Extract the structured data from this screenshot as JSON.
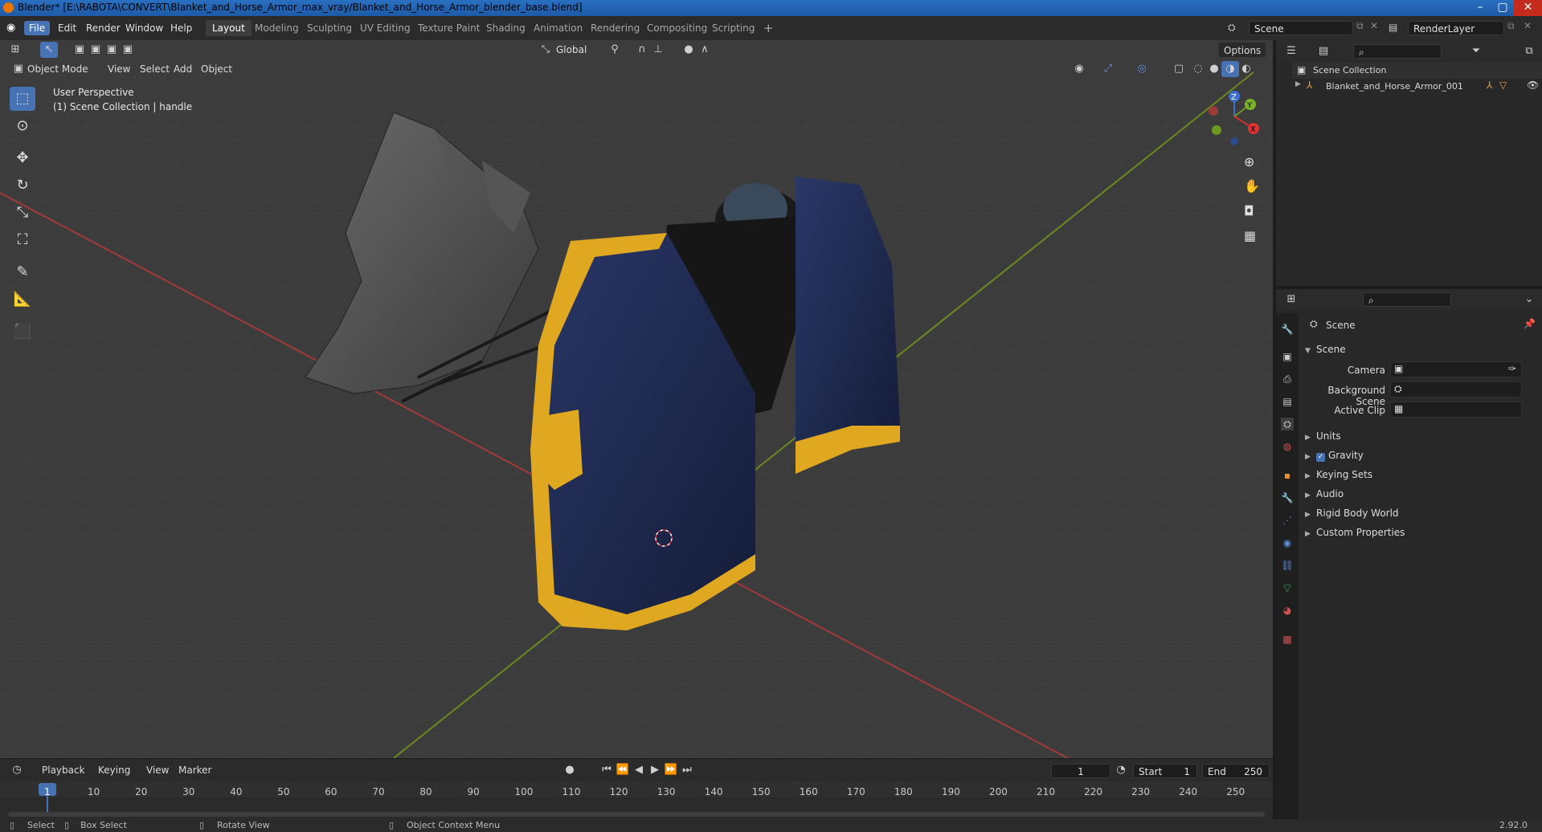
{
  "titlebar": {
    "title": "Blender* [E:\\RABOTA\\CONVERT\\Blanket_and_Horse_Armor_max_vray/Blanket_and_Horse_Armor_blender_base.blend]",
    "minimize": "–",
    "maximize": "▢",
    "close": "✕"
  },
  "menus": [
    "File",
    "Edit",
    "Render",
    "Window",
    "Help"
  ],
  "workspaces": [
    "Layout",
    "Modeling",
    "Sculpting",
    "UV Editing",
    "Texture Paint",
    "Shading",
    "Animation",
    "Rendering",
    "Compositing",
    "Scripting"
  ],
  "add_workspace": "+",
  "scene_field": "Scene",
  "renderlayer_field": "RenderLayer",
  "viewport": {
    "transform_orientation": "Global",
    "options": "Options",
    "mode": "Object Mode",
    "header_menus": [
      "View",
      "Select",
      "Add",
      "Object"
    ],
    "overlay_line1": "User Perspective",
    "overlay_line2": "(1) Scene Collection | handle",
    "gizmo": {
      "x": "X",
      "y": "Y",
      "z": "Z"
    }
  },
  "timeline": {
    "menus": [
      "Playback",
      "Keying",
      "View",
      "Marker"
    ],
    "current_frame": "1",
    "start_label": "Start",
    "start_value": "1",
    "end_label": "End",
    "end_value": "250",
    "ruler": [
      "1",
      "10",
      "20",
      "30",
      "40",
      "50",
      "60",
      "70",
      "80",
      "90",
      "100",
      "110",
      "120",
      "130",
      "140",
      "150",
      "160",
      "170",
      "180",
      "190",
      "200",
      "210",
      "220",
      "230",
      "240",
      "250"
    ]
  },
  "statusbar": {
    "select": "Select",
    "box_select": "Box Select",
    "rotate_view": "Rotate View",
    "context_menu": "Object Context Menu",
    "version": "2.92.0"
  },
  "outliner": {
    "root": "Scene Collection",
    "item": "Blanket_and_Horse_Armor_001"
  },
  "properties": {
    "context": "Scene",
    "panel_title": "Scene",
    "camera_label": "Camera",
    "background_scene_label": "Background Scene",
    "active_clip_label": "Active Clip",
    "sections": [
      "Units",
      "Gravity",
      "Keying Sets",
      "Audio",
      "Rigid Body World",
      "Custom Properties"
    ]
  },
  "colors": {
    "accent": "#4772b3",
    "viewport_bg": "#3d3d3d",
    "panel_bg": "#282828",
    "blanket": "#1e2a4e",
    "trim": "#e0a820"
  }
}
